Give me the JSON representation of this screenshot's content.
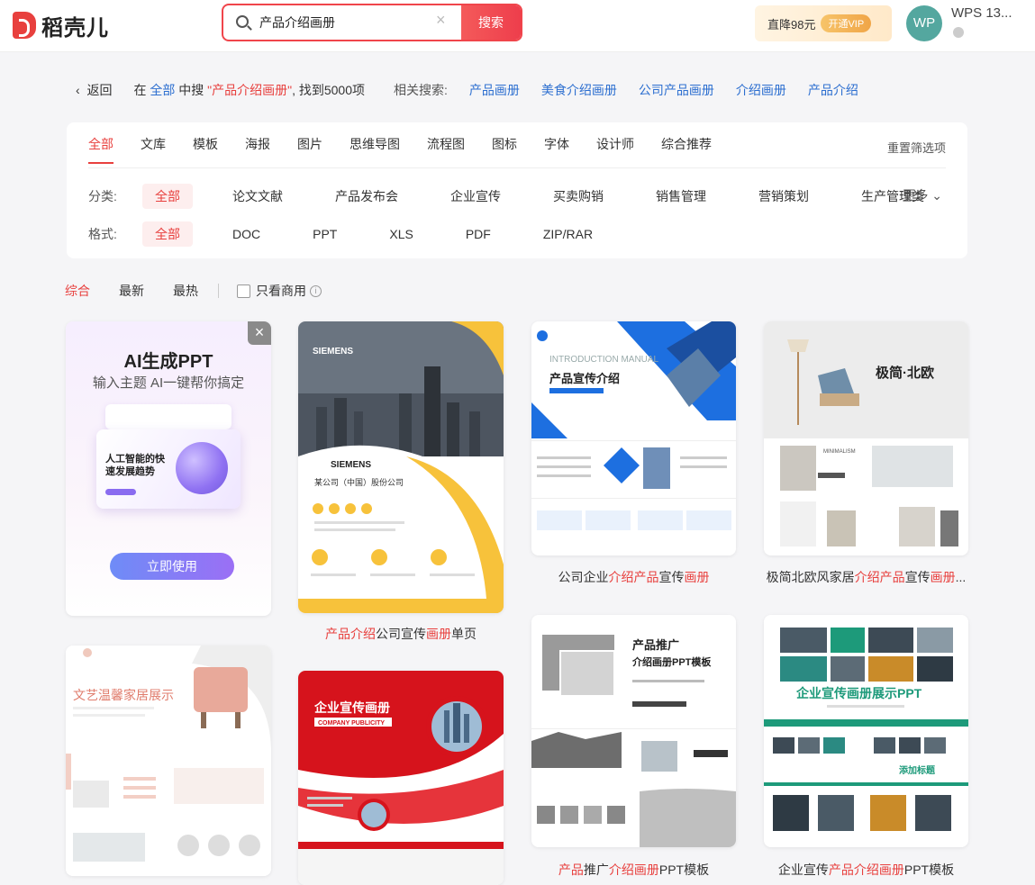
{
  "header": {
    "logo_text": "稻壳儿",
    "search_value": "产品介绍画册",
    "search_button": "搜索",
    "clear_icon": "×",
    "vip_text": "直降98元",
    "vip_button": "开通VIP",
    "avatar_initials": "WP",
    "user_name": "WPS 13..."
  },
  "results": {
    "back": "返回",
    "in_text": "在",
    "scope": "全部",
    "mid_text": "中搜",
    "query": "\"产品介绍画册\"",
    "count_text": ", 找到5000项",
    "related_label": "相关搜索:",
    "related": [
      "产品画册",
      "美食介绍画册",
      "公司产品画册",
      "介绍画册",
      "产品介绍"
    ]
  },
  "filter": {
    "tabs": [
      "全部",
      "文库",
      "模板",
      "海报",
      "图片",
      "思维导图",
      "流程图",
      "图标",
      "字体",
      "设计师",
      "综合推荐"
    ],
    "reset": "重置筛选项",
    "category_label": "分类:",
    "categories": [
      "全部",
      "论文文献",
      "产品发布会",
      "企业宣传",
      "买卖购销",
      "销售管理",
      "营销策划",
      "生产管理类"
    ],
    "more": "更多",
    "format_label": "格式:",
    "formats": [
      "全部",
      "DOC",
      "PPT",
      "XLS",
      "PDF",
      "ZIP/RAR"
    ]
  },
  "sort": {
    "options": [
      "综合",
      "最新",
      "最热"
    ],
    "commercial_only": "只看商用"
  },
  "ai_card": {
    "title": "AI生成PPT",
    "subtitle": "输入主题 AI一键帮你搞定",
    "mock_title": "人工智能的快速发展趋势",
    "button": "立即使用"
  },
  "cards": [
    {
      "thumb_text_1": "SIEMENS",
      "thumb_text_2": "某公司（中国）股份公司",
      "caption": [
        {
          "t": "产品介绍",
          "r": true
        },
        {
          "t": "公司宣传",
          "r": false
        },
        {
          "t": "画册",
          "r": true
        },
        {
          "t": "单页",
          "r": false
        }
      ]
    },
    {
      "thumb_text_1": "INTRODUCTION MANUAL",
      "thumb_text_2": "产品宣传介绍",
      "caption": [
        {
          "t": "公司企业",
          "r": false
        },
        {
          "t": "介绍产品",
          "r": true
        },
        {
          "t": "宣传",
          "r": false
        },
        {
          "t": "画册",
          "r": true
        }
      ]
    },
    {
      "thumb_text_1": "极简·北欧",
      "thumb_text_2": "MINIMALISM",
      "caption": [
        {
          "t": "极简北欧风家居",
          "r": false
        },
        {
          "t": "介绍产品",
          "r": true
        },
        {
          "t": "宣传",
          "r": false
        },
        {
          "t": "画册",
          "r": true
        },
        {
          "t": "...",
          "r": false
        }
      ]
    },
    {
      "thumb_text_1": "文艺温馨家居展示",
      "thumb_text_2": "",
      "caption": []
    },
    {
      "thumb_text_1": "企业宣传画册",
      "thumb_text_2": "COMPANY PUBLICITY",
      "caption": []
    },
    {
      "thumb_text_1": "产品推广",
      "thumb_text_2": "介绍画册PPT模板",
      "caption": [
        {
          "t": "产品",
          "r": true
        },
        {
          "t": "推广",
          "r": false
        },
        {
          "t": "介绍画册",
          "r": true
        },
        {
          "t": "PPT模板",
          "r": false
        }
      ]
    },
    {
      "thumb_text_1": "企业宣传画册展示PPT",
      "thumb_text_2": "添加标题",
      "caption": [
        {
          "t": "企业宣传",
          "r": false
        },
        {
          "t": "产品介绍画册",
          "r": true
        },
        {
          "t": "PPT模板",
          "r": false
        }
      ]
    }
  ]
}
